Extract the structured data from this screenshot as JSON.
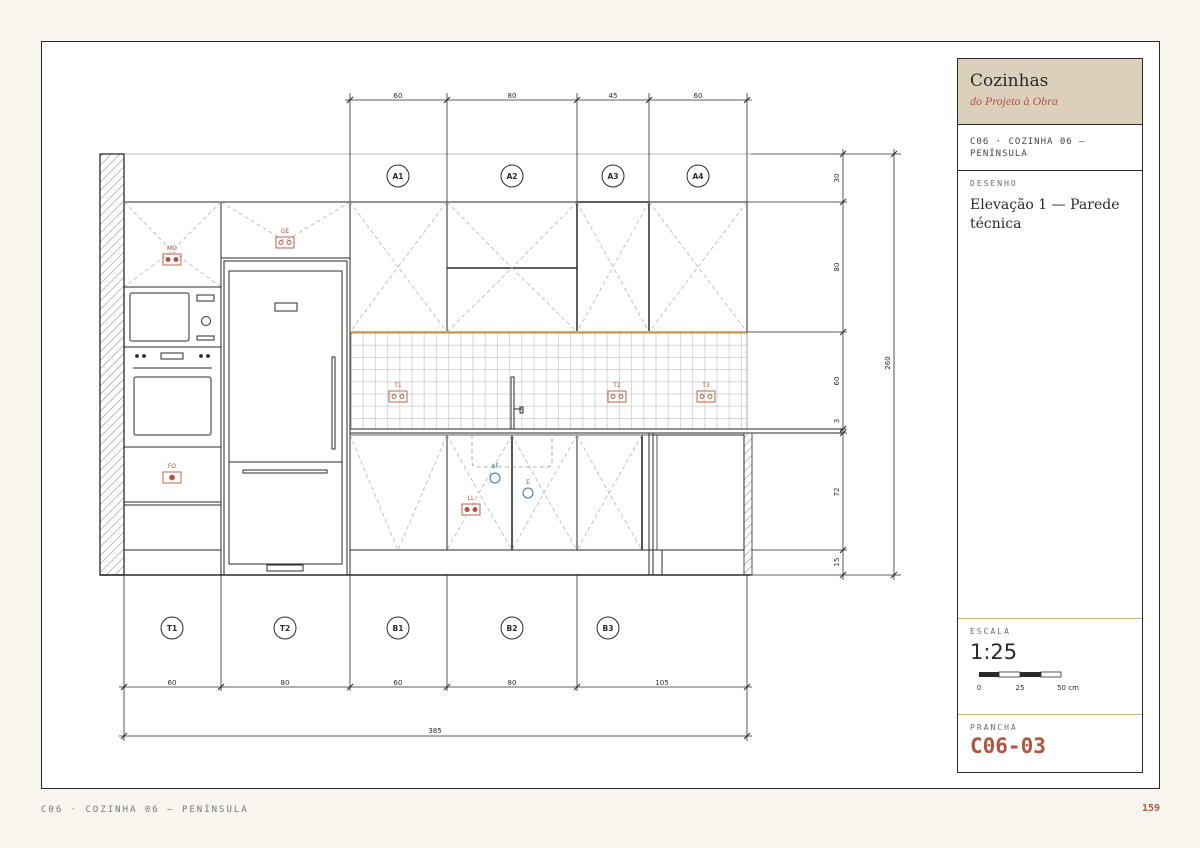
{
  "title_block": {
    "title": "Cozinhas",
    "subtitle": "do Projeto à Obra",
    "chapter": "C06 · COZINHA 06 — PENÍNSULA",
    "drawing_label": "DESENHO",
    "drawing_name": "Elevação 1 — Parede técnica",
    "scale_label": "ESCALA",
    "scale_value": "1:25",
    "scalebar_ticks": [
      "0",
      "25",
      "50 cm"
    ],
    "sheet_label": "PRANCHA",
    "sheet_value": "C06-03"
  },
  "footer": {
    "left": "C06 · COZINHA 06 — PENÍNSULA",
    "page_number": "159"
  },
  "elevation": {
    "upper_module_tags": [
      "A1",
      "A2",
      "A3",
      "A4"
    ],
    "lower_module_tags": [
      "T1",
      "T2",
      "B1",
      "B2",
      "B3"
    ],
    "top_dimensions": [
      "60",
      "80",
      "45",
      "60"
    ],
    "bottom_dimensions": [
      "60",
      "80",
      "60",
      "80",
      "105"
    ],
    "overall_width": "385",
    "right_dimensions": [
      "30",
      "80",
      "60",
      "3",
      "72",
      "15"
    ],
    "overall_height": "260",
    "point_labels": {
      "microwave": "MO",
      "fridge": "GE",
      "oven": "FO",
      "dishwasher": "LL",
      "socket_1": "T1",
      "socket_2": "T2",
      "socket_3": "T3",
      "cold_water": "AF",
      "drain": "E"
    },
    "colors": {
      "line": "#2a2a2a",
      "accent": "#b0553f",
      "water": "#3d6ea8",
      "led": "#d8b85a",
      "tile": "#bdbdbd"
    }
  }
}
